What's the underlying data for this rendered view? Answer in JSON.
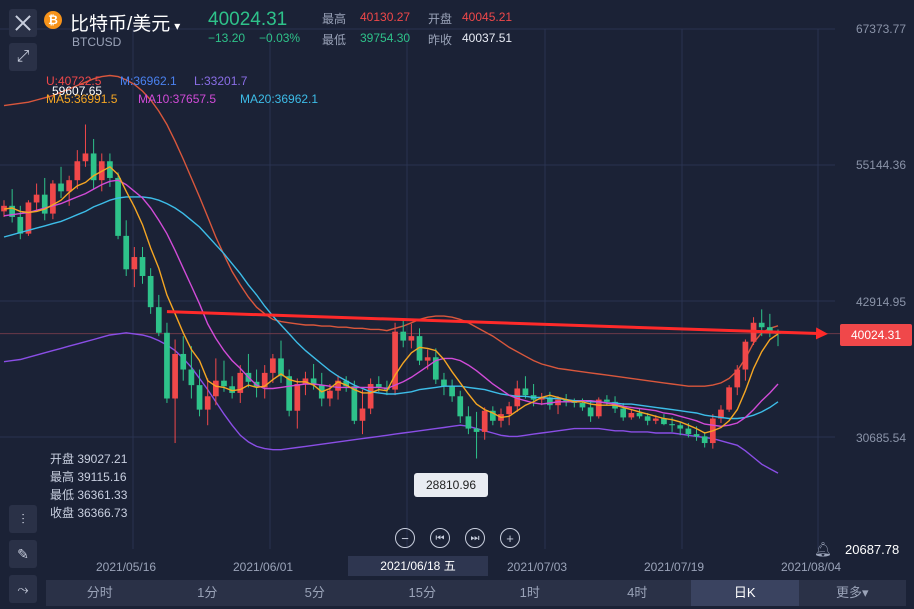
{
  "header": {
    "coin_glyph": "₿",
    "title": "比特币/美元",
    "caret": "▾",
    "symbol": "BTCUSD",
    "price": "40024.31",
    "change": "−13.20",
    "change_pct": "−0.03%",
    "high_label": "最高",
    "high": "40130.27",
    "open_label": "开盘",
    "open": "40045.21",
    "low_label": "最低",
    "low": "39754.30",
    "prev_label": "昨收",
    "prev": "40037.51"
  },
  "indicators": {
    "u": "U:40722.5",
    "m": "M:36962.1",
    "l": "L:33201.7",
    "max_marker": "59607.65",
    "ma5": "MA5:36991.5",
    "ma10": "MA10:37657.5",
    "ma20": "MA20:36962.1"
  },
  "ohlc": {
    "open": "开盘 39027.21",
    "high": "最高 39115.16",
    "low": "最低 36361.33",
    "close": "收盘 36366.73"
  },
  "tooltip": "28810.96",
  "price_tag": "40024.31",
  "y_axis": [
    "67373.77",
    "55144.36",
    "42914.95",
    "30685.54"
  ],
  "y_low": "20687.78",
  "x_axis": [
    "2021/05/16",
    "2021/06/01",
    "2021/07/03",
    "2021/07/19",
    "2021/08/04"
  ],
  "x_selected": "2021/06/18 五",
  "tabs": [
    "分时",
    "1分",
    "5分",
    "15分",
    "1时",
    "4时",
    "日K",
    "更多▾"
  ],
  "active_tab": "日K",
  "colors": {
    "up": "#f0484a",
    "down": "#2ec28a",
    "ma5": "#f5a623",
    "ma10": "#d14bd8",
    "ma20": "#3dbde8",
    "boll_u": "#d9573c",
    "boll_l": "#8a4ee6",
    "trend": "#ff2a2a"
  },
  "chart_data": {
    "type": "candlestick",
    "candles": [
      [
        51000,
        52000,
        50500,
        51500
      ],
      [
        51500,
        53000,
        50000,
        50500
      ],
      [
        50500,
        51500,
        48500,
        49000
      ],
      [
        49000,
        52000,
        48800,
        51800
      ],
      [
        51800,
        53500,
        51000,
        52500
      ],
      [
        52500,
        54000,
        50200,
        50800
      ],
      [
        50800,
        53800,
        50300,
        53500
      ],
      [
        53500,
        55000,
        52200,
        52800
      ],
      [
        52800,
        54200,
        51500,
        53800
      ],
      [
        53800,
        56500,
        53000,
        55500
      ],
      [
        55500,
        58800,
        55000,
        56200
      ],
      [
        56200,
        57500,
        53000,
        53800
      ],
      [
        53800,
        56200,
        52800,
        55500
      ],
      [
        55500,
        56200,
        53200,
        54000
      ],
      [
        54000,
        54500,
        48500,
        48800
      ],
      [
        48800,
        50200,
        45200,
        45800
      ],
      [
        45800,
        47800,
        44200,
        46900
      ],
      [
        46900,
        47800,
        44500,
        45200
      ],
      [
        45200,
        45900,
        41800,
        42400
      ],
      [
        42400,
        43500,
        39800,
        40100
      ],
      [
        40100,
        41000,
        33800,
        34200
      ],
      [
        34200,
        39500,
        30200,
        38200
      ],
      [
        38200,
        39800,
        35800,
        36800
      ],
      [
        36800,
        38900,
        34200,
        35400
      ],
      [
        35400,
        36800,
        32600,
        33200
      ],
      [
        33200,
        36000,
        31800,
        34400
      ],
      [
        34400,
        37800,
        33600,
        35800
      ],
      [
        35800,
        37600,
        34800,
        35300
      ],
      [
        35300,
        36200,
        34200,
        34700
      ],
      [
        34700,
        37200,
        33800,
        36500
      ],
      [
        36500,
        38200,
        35200,
        35700
      ],
      [
        35700,
        36800,
        34300,
        35200
      ],
      [
        35200,
        37200,
        34200,
        36500
      ],
      [
        36500,
        38200,
        35600,
        37800
      ],
      [
        37800,
        39400,
        35600,
        36200
      ],
      [
        36200,
        36800,
        32600,
        33100
      ],
      [
        33100,
        36000,
        31500,
        35500
      ],
      [
        35500,
        36600,
        34500,
        36000
      ],
      [
        36000,
        37300,
        35000,
        35400
      ],
      [
        35400,
        36500,
        33500,
        34200
      ],
      [
        34200,
        35500,
        33500,
        34900
      ],
      [
        34900,
        36300,
        34100,
        35800
      ],
      [
        35800,
        36200,
        34800,
        35300
      ],
      [
        35300,
        35800,
        31900,
        32200
      ],
      [
        32200,
        35000,
        31000,
        33300
      ],
      [
        33300,
        36000,
        32800,
        35500
      ],
      [
        35500,
        36200,
        34800,
        35200
      ],
      [
        35200,
        35800,
        34500,
        35000
      ],
      [
        35000,
        41000,
        34500,
        40200
      ],
      [
        40200,
        41300,
        38800,
        39400
      ],
      [
        39400,
        40900,
        38700,
        39800
      ],
      [
        39800,
        40500,
        37200,
        37600
      ],
      [
        37600,
        38600,
        36800,
        37900
      ],
      [
        37900,
        38700,
        35500,
        35900
      ],
      [
        35900,
        36500,
        34500,
        35300
      ],
      [
        35300,
        35900,
        33900,
        34400
      ],
      [
        34400,
        34900,
        32000,
        32600
      ],
      [
        32600,
        33500,
        31000,
        31500
      ],
      [
        31500,
        33000,
        28810.96,
        31200
      ],
      [
        31200,
        33400,
        30500,
        33100
      ],
      [
        33100,
        33500,
        31800,
        32200
      ],
      [
        32200,
        33300,
        31600,
        32800
      ],
      [
        32800,
        33900,
        31800,
        33500
      ],
      [
        33500,
        35800,
        33000,
        35100
      ],
      [
        35100,
        36200,
        34200,
        34500
      ],
      [
        34500,
        35500,
        33500,
        34100
      ],
      [
        34100,
        34700,
        33600,
        34300
      ],
      [
        34300,
        34800,
        33200,
        33600
      ],
      [
        33600,
        34400,
        32800,
        34100
      ],
      [
        34100,
        34600,
        33500,
        33900
      ],
      [
        33900,
        34200,
        33400,
        33800
      ],
      [
        33800,
        34200,
        33100,
        33400
      ],
      [
        33400,
        33900,
        32100,
        32600
      ],
      [
        32600,
        34300,
        32400,
        34100
      ],
      [
        34100,
        34500,
        33600,
        33900
      ],
      [
        33900,
        34400,
        32900,
        33300
      ],
      [
        33300,
        33800,
        32200,
        32500
      ],
      [
        32500,
        33200,
        32300,
        32900
      ],
      [
        32900,
        33300,
        32400,
        32600
      ],
      [
        32600,
        32900,
        31800,
        32200
      ],
      [
        32200,
        32700,
        31900,
        32400
      ],
      [
        32400,
        32800,
        31800,
        31900
      ],
      [
        31900,
        32500,
        31200,
        31800
      ],
      [
        31800,
        32100,
        30900,
        31500
      ],
      [
        31500,
        32000,
        30700,
        31000
      ],
      [
        31000,
        31700,
        30400,
        30800
      ],
      [
        30800,
        31200,
        29800,
        30200
      ],
      [
        30200,
        32800,
        29700,
        32400
      ],
      [
        32400,
        33600,
        32000,
        33200
      ],
      [
        33200,
        35400,
        33000,
        35200
      ],
      [
        35200,
        37200,
        34500,
        36800
      ],
      [
        36800,
        39500,
        35800,
        39300
      ],
      [
        39300,
        41500,
        39000,
        41000
      ],
      [
        41000,
        42200,
        39800,
        40600
      ],
      [
        40600,
        41800,
        39700,
        40100
      ],
      [
        40100,
        40400,
        38900,
        40024.31
      ]
    ],
    "ma5": [
      51200,
      51300,
      51000,
      50900,
      51000,
      51200,
      51600,
      52000,
      52700,
      53300,
      53600,
      54200,
      54600,
      55000,
      54300,
      52800,
      51400,
      49800,
      47700,
      45900,
      43500,
      41800,
      40100,
      38600,
      37600,
      35800,
      35300,
      35200,
      34900,
      35000,
      35400,
      35200,
      35300,
      35900,
      36400,
      35900,
      35700,
      35700,
      35400,
      34800,
      35100,
      35700,
      35400,
      35000,
      34700,
      34700,
      35000,
      34900,
      36300,
      37400,
      38300,
      38800,
      38700,
      38500,
      37700,
      36600,
      35600,
      34600,
      33700,
      33200,
      32900,
      32500,
      32600,
      33100,
      33600,
      33900,
      34300,
      34500,
      34300,
      34100,
      33900,
      33900,
      33700,
      33600,
      33600,
      33600,
      33400,
      33200,
      33000,
      32800,
      32600,
      32400,
      32300,
      32100,
      31800,
      31500,
      31100,
      31300,
      31600,
      32200,
      33200,
      34900,
      36900,
      38400,
      39500,
      40000
    ],
    "ma10": [
      50600,
      50700,
      50800,
      50900,
      51100,
      51300,
      51500,
      51700,
      52000,
      52300,
      52600,
      53000,
      53400,
      53700,
      53800,
      53400,
      52800,
      52200,
      51300,
      50200,
      49000,
      47500,
      45900,
      44300,
      42700,
      40900,
      39600,
      38500,
      37600,
      36900,
      36100,
      35400,
      35100,
      35100,
      35200,
      35300,
      35400,
      35500,
      35500,
      35400,
      35300,
      35200,
      35200,
      35200,
      35200,
      35200,
      35200,
      35100,
      35400,
      35700,
      36100,
      36600,
      37100,
      37600,
      37800,
      37800,
      37600,
      37200,
      36700,
      36100,
      35500,
      35000,
      34500,
      34200,
      34000,
      33800,
      33700,
      33800,
      33900,
      33900,
      33900,
      34000,
      34000,
      33900,
      33800,
      33700,
      33500,
      33400,
      33300,
      33200,
      33100,
      32900,
      32800,
      32600,
      32400,
      32200,
      31900,
      31800,
      31700,
      31800,
      32000,
      32500,
      33200,
      34000,
      34700,
      35500
    ],
    "ma20": [
      48700,
      48900,
      49100,
      49300,
      49500,
      49700,
      49900,
      50100,
      50400,
      50700,
      51000,
      51400,
      51700,
      52000,
      52200,
      52300,
      52300,
      52300,
      52200,
      52000,
      51700,
      51300,
      50800,
      50200,
      49600,
      48800,
      48000,
      47200,
      46300,
      45400,
      44400,
      43500,
      42500,
      41600,
      40800,
      40000,
      39200,
      38500,
      37900,
      37300,
      36700,
      36200,
      35800,
      35400,
      35100,
      34800,
      34700,
      34600,
      34600,
      34700,
      34800,
      35000,
      35100,
      35200,
      35300,
      35300,
      35300,
      35200,
      35100,
      35000,
      34800,
      34600,
      34500,
      34400,
      34400,
      34300,
      34300,
      34200,
      34200,
      34100,
      34000,
      34000,
      33900,
      33900,
      33800,
      33800,
      33700,
      33700,
      33600,
      33500,
      33400,
      33300,
      33200,
      33100,
      33000,
      32900,
      32700,
      32600,
      32500,
      32400,
      32400,
      32500,
      32700,
      33000,
      33400,
      33900
    ],
    "boll_u": [
      60500,
      60600,
      60700,
      60800,
      61000,
      61200,
      61400,
      61700,
      62000,
      62300,
      62600,
      62900,
      63100,
      63200,
      63100,
      62800,
      62400,
      61800,
      61000,
      60000,
      58800,
      57300,
      55700,
      54000,
      52300,
      50500,
      48700,
      47100,
      45600,
      44400,
      43300,
      42400,
      41800,
      41300,
      41100,
      41000,
      40900,
      40800,
      40800,
      40700,
      40700,
      40600,
      40600,
      40500,
      40500,
      40400,
      40400,
      40300,
      40500,
      40700,
      41000,
      41300,
      41500,
      41600,
      41600,
      41500,
      41300,
      41000,
      40600,
      40200,
      39800,
      39300,
      38800,
      38400,
      38000,
      37600,
      37300,
      37100,
      36900,
      36800,
      36700,
      36600,
      36500,
      36400,
      36300,
      36200,
      36100,
      36000,
      35900,
      35800,
      35700,
      35600,
      35500,
      35400,
      35300,
      35300,
      35300,
      35400,
      35600,
      36000,
      36700,
      37800,
      39200,
      40100,
      40500,
      40722.5
    ],
    "boll_l": [
      37500,
      37600,
      37700,
      37900,
      38100,
      38300,
      38500,
      38700,
      38900,
      39100,
      39300,
      39500,
      39700,
      39900,
      40000,
      40100,
      40000,
      39900,
      39700,
      39400,
      39000,
      38500,
      37800,
      37000,
      36000,
      35000,
      33900,
      32800,
      31800,
      30900,
      30300,
      29900,
      29700,
      29600,
      29600,
      29700,
      29800,
      29900,
      30000,
      30100,
      30200,
      30300,
      30400,
      30500,
      30600,
      30700,
      30800,
      30900,
      31000,
      31100,
      31200,
      31300,
      31400,
      31500,
      31600,
      31700,
      31800,
      31700,
      31500,
      31300,
      31100,
      30900,
      30800,
      30800,
      30900,
      31000,
      31100,
      31200,
      31300,
      31400,
      31500,
      31500,
      31500,
      31500,
      31400,
      31300,
      31300,
      31200,
      31200,
      31200,
      31100,
      31100,
      31100,
      31000,
      30900,
      30800,
      30700,
      30600,
      30400,
      30200,
      30000,
      29500,
      28900,
      28300,
      27900,
      27500
    ],
    "trend_line": {
      "from_index": 20,
      "from_value": 42000,
      "to_index": 96,
      "to_value": 40024.31
    },
    "y_min": 20687.78,
    "y_max": 67373.77
  }
}
